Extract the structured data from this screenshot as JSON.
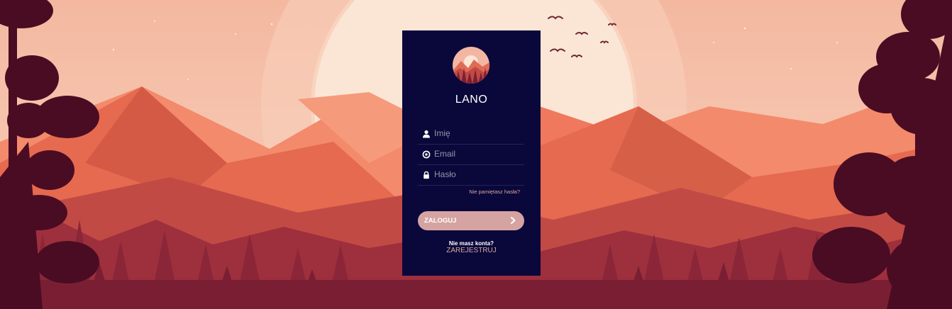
{
  "brand": {
    "title": "LANO"
  },
  "form": {
    "name_placeholder": "Imię",
    "email_placeholder": "Email",
    "password_placeholder": "Hasło",
    "forgot_link": "Nie pamiętasz hasła?",
    "login_button": "ZALOGUJ",
    "no_account_text": "Nie masz konta?",
    "register_link": "ZAREJESTRUJ"
  },
  "icons": {
    "name": "user-icon",
    "email": "at-icon",
    "password": "lock-icon",
    "login": "chevron-right-icon"
  },
  "colors": {
    "card_background": "#0a073a",
    "button_background": "#d5a4a2",
    "link_color": "#d7a9a4",
    "sky": "#f6c9b2",
    "sun": "#fbe3d1"
  }
}
